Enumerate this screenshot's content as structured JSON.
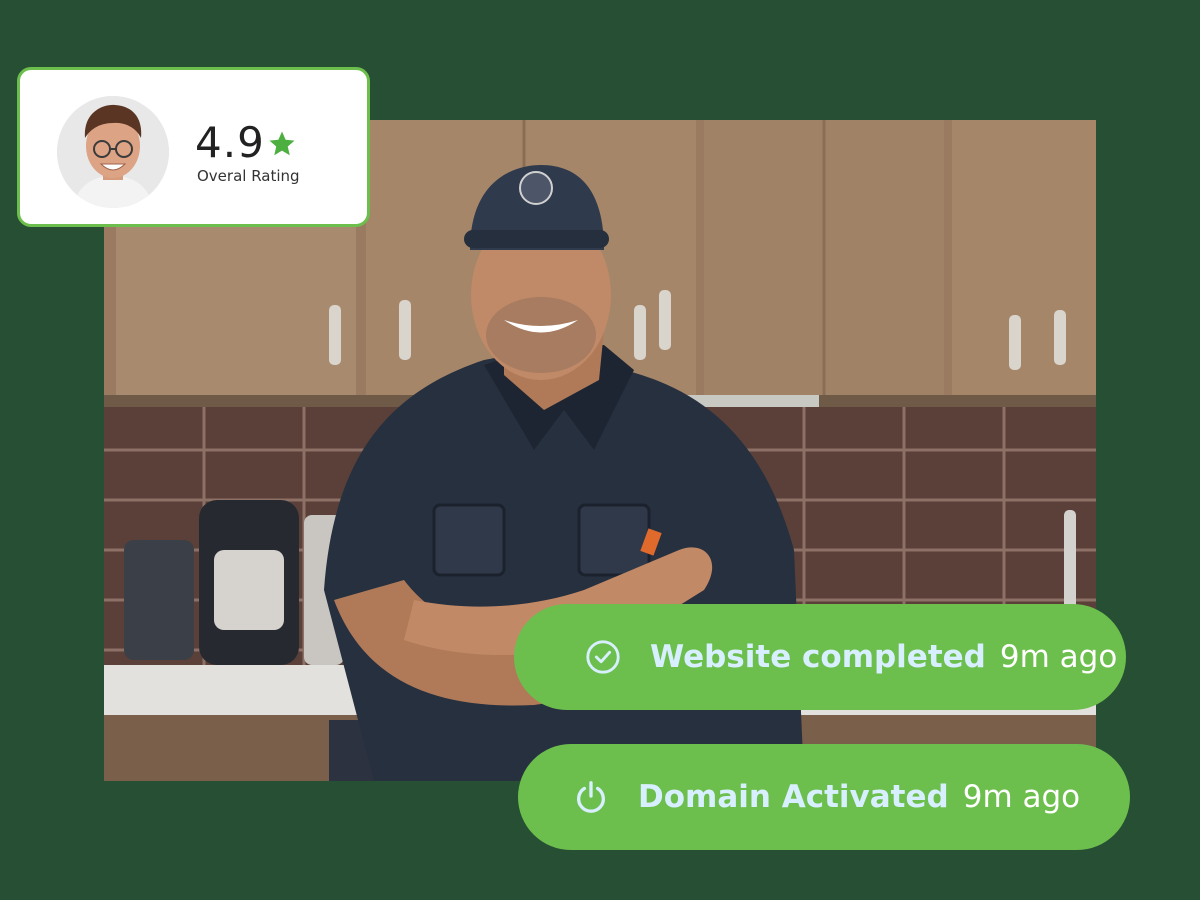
{
  "rating_card": {
    "value": "4.9",
    "label": "Overal Rating",
    "star_icon": "star-icon",
    "avatar_icon": "avatar"
  },
  "notifications": [
    {
      "icon": "check-circle-icon",
      "label": "Website completed",
      "time": "9m ago"
    },
    {
      "icon": "power-icon",
      "label": "Domain Activated",
      "time": "9m ago"
    }
  ],
  "colors": {
    "background": "#274f34",
    "accent_green": "#6cbf4d",
    "pill_text": "#d8efff"
  },
  "photo": {
    "subject": "smiling technician with crossed arms in kitchen"
  }
}
